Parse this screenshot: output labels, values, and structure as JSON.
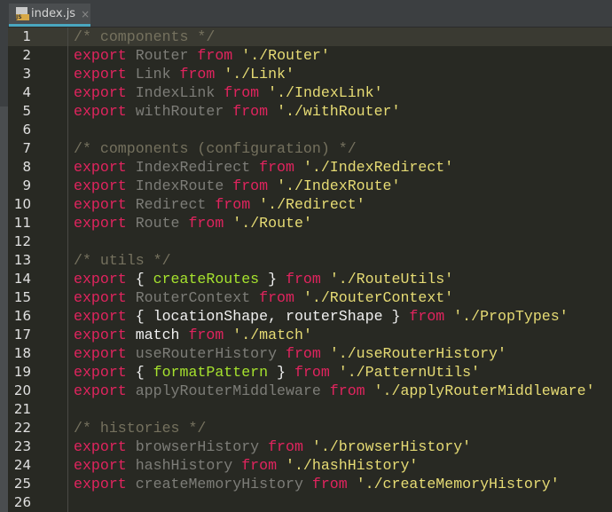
{
  "tab": {
    "label": "index.js",
    "badge": "JS",
    "close": "×"
  },
  "lines": [
    [
      [
        "cm",
        "/* components */"
      ]
    ],
    [
      [
        "kw",
        "export"
      ],
      [
        "dim",
        " Router "
      ],
      [
        "kw",
        "from"
      ],
      [
        "id",
        " "
      ],
      [
        "str",
        "'./Router'"
      ]
    ],
    [
      [
        "kw",
        "export"
      ],
      [
        "dim",
        " Link "
      ],
      [
        "kw",
        "from"
      ],
      [
        "id",
        " "
      ],
      [
        "str",
        "'./Link'"
      ]
    ],
    [
      [
        "kw",
        "export"
      ],
      [
        "dim",
        " IndexLink "
      ],
      [
        "kw",
        "from"
      ],
      [
        "id",
        " "
      ],
      [
        "str",
        "'./IndexLink'"
      ]
    ],
    [
      [
        "kw",
        "export"
      ],
      [
        "dim",
        " withRouter "
      ],
      [
        "kw",
        "from"
      ],
      [
        "id",
        " "
      ],
      [
        "str",
        "'./withRouter'"
      ]
    ],
    [],
    [
      [
        "cm",
        "/* components (configuration) */"
      ]
    ],
    [
      [
        "kw",
        "export"
      ],
      [
        "dim",
        " IndexRedirect "
      ],
      [
        "kw",
        "from"
      ],
      [
        "id",
        " "
      ],
      [
        "str",
        "'./IndexRedirect'"
      ]
    ],
    [
      [
        "kw",
        "export"
      ],
      [
        "dim",
        " IndexRoute "
      ],
      [
        "kw",
        "from"
      ],
      [
        "id",
        " "
      ],
      [
        "str",
        "'./IndexRoute'"
      ]
    ],
    [
      [
        "kw",
        "export"
      ],
      [
        "dim",
        " Redirect "
      ],
      [
        "kw",
        "from"
      ],
      [
        "id",
        " "
      ],
      [
        "str",
        "'./Redirect'"
      ]
    ],
    [
      [
        "kw",
        "export"
      ],
      [
        "dim",
        " Route "
      ],
      [
        "kw",
        "from"
      ],
      [
        "id",
        " "
      ],
      [
        "str",
        "'./Route'"
      ]
    ],
    [],
    [
      [
        "cm",
        "/* utils */"
      ]
    ],
    [
      [
        "kw",
        "export"
      ],
      [
        "id",
        " { "
      ],
      [
        "fn",
        "createRoutes"
      ],
      [
        "id",
        " } "
      ],
      [
        "kw",
        "from"
      ],
      [
        "id",
        " "
      ],
      [
        "str",
        "'./RouteUtils'"
      ]
    ],
    [
      [
        "kw",
        "export"
      ],
      [
        "dim",
        " RouterContext "
      ],
      [
        "kw",
        "from"
      ],
      [
        "id",
        " "
      ],
      [
        "str",
        "'./RouterContext'"
      ]
    ],
    [
      [
        "kw",
        "export"
      ],
      [
        "id",
        " { locationShape, routerShape } "
      ],
      [
        "kw",
        "from"
      ],
      [
        "id",
        " "
      ],
      [
        "str",
        "'./PropTypes'"
      ]
    ],
    [
      [
        "kw",
        "export"
      ],
      [
        "id",
        " match "
      ],
      [
        "kw",
        "from"
      ],
      [
        "id",
        " "
      ],
      [
        "str",
        "'./match'"
      ]
    ],
    [
      [
        "kw",
        "export"
      ],
      [
        "dim",
        " useRouterHistory "
      ],
      [
        "kw",
        "from"
      ],
      [
        "id",
        " "
      ],
      [
        "str",
        "'./useRouterHistory'"
      ]
    ],
    [
      [
        "kw",
        "export"
      ],
      [
        "id",
        " { "
      ],
      [
        "fn",
        "formatPattern"
      ],
      [
        "id",
        " } "
      ],
      [
        "kw",
        "from"
      ],
      [
        "id",
        " "
      ],
      [
        "str",
        "'./PatternUtils'"
      ]
    ],
    [
      [
        "kw",
        "export"
      ],
      [
        "dim",
        " applyRouterMiddleware "
      ],
      [
        "kw",
        "from"
      ],
      [
        "id",
        " "
      ],
      [
        "str",
        "'./applyRouterMiddleware'"
      ]
    ],
    [],
    [
      [
        "cm",
        "/* histories */"
      ]
    ],
    [
      [
        "kw",
        "export"
      ],
      [
        "dim",
        " browserHistory "
      ],
      [
        "kw",
        "from"
      ],
      [
        "id",
        " "
      ],
      [
        "str",
        "'./browserHistory'"
      ]
    ],
    [
      [
        "kw",
        "export"
      ],
      [
        "dim",
        " hashHistory "
      ],
      [
        "kw",
        "from"
      ],
      [
        "id",
        " "
      ],
      [
        "str",
        "'./hashHistory'"
      ]
    ],
    [
      [
        "kw",
        "export"
      ],
      [
        "dim",
        " createMemoryHistory "
      ],
      [
        "kw",
        "from"
      ],
      [
        "id",
        " "
      ],
      [
        "str",
        "'./createMemoryHistory'"
      ]
    ],
    []
  ]
}
